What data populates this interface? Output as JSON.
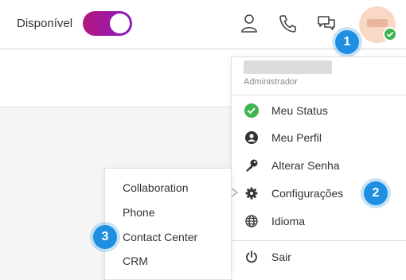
{
  "topbar": {
    "status_label": "Disponível",
    "status_toggle_on": true,
    "toggle_color": "#9a1aa8",
    "icons": [
      "user-icon",
      "phone-icon",
      "chat-icon"
    ],
    "avatar_status_color": "#3fb550"
  },
  "menu": {
    "role": "Administrador",
    "items": [
      {
        "label": "Meu Status",
        "icon": "check-circle-icon",
        "icon_color": "#3fb550"
      },
      {
        "label": "Meu Perfil",
        "icon": "profile-icon"
      },
      {
        "label": "Alterar Senha",
        "icon": "key-icon"
      },
      {
        "label": "Configurações",
        "icon": "gear-icon"
      },
      {
        "label": "Idioma",
        "icon": "globe-icon"
      },
      {
        "label": "Sair",
        "icon": "power-icon"
      }
    ]
  },
  "submenu": {
    "items": [
      "Collaboration",
      "Phone",
      "Contact Center",
      "CRM"
    ]
  },
  "annotations": {
    "step1": "1",
    "step2": "2",
    "step3": "3",
    "color": "#1e8fe1"
  }
}
